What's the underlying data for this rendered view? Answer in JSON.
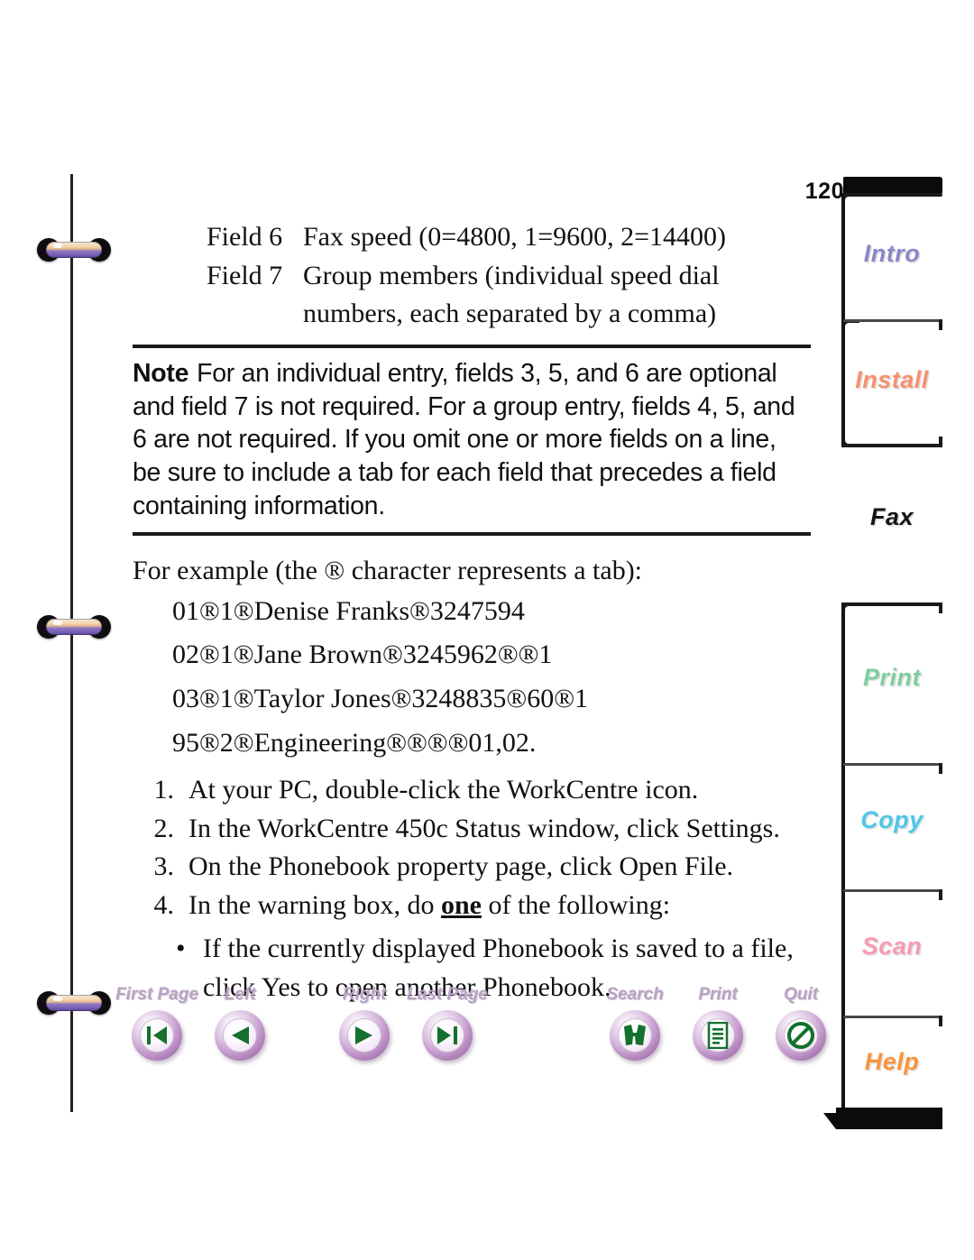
{
  "page": {
    "number": "120"
  },
  "fields": [
    {
      "label": "Field 6",
      "text": "Fax speed (0=4800, 1=9600, 2=14400)"
    },
    {
      "label": "Field 7",
      "text": "Group members (individual speed dial",
      "cont": "numbers, each separated by a comma)"
    }
  ],
  "note": {
    "word": "Note",
    "body": "For an individual entry, fields 3, 5, and 6 are optional and field 7 is not required. For a group entry, fields 4, 5, and 6 are not required. If you omit one or more fields on a line, be sure to include a tab for each field that precedes a field containing information."
  },
  "example": {
    "intro": "For example (the ® character represents a tab):",
    "lines": [
      "01®1®Denise Franks®3247594",
      "02®1®Jane Brown®3245962®®1",
      "03®1®Taylor Jones®3248835®60®1",
      "95®2®Engineering®®®®01,02."
    ]
  },
  "steps": [
    {
      "num": "1.",
      "text": "At your PC, double-click the WorkCentre icon."
    },
    {
      "num": "2.",
      "text": "In the WorkCentre 450c Status window, click Settings."
    },
    {
      "num": "3.",
      "text": "On the Phonebook property page, click Open File."
    },
    {
      "num": "4.",
      "pre": "In the warning box, do ",
      "emphasis": "one",
      "post": " of the following:"
    }
  ],
  "bullets": [
    {
      "dot": "•",
      "line1": "If the currently displayed Phonebook is saved to a",
      "line2": "file, click Yes to open another Phonebook."
    }
  ],
  "navbar": {
    "left": [
      {
        "label": "First Page",
        "icon": "first-page-icon"
      },
      {
        "label": "Left",
        "icon": "previous-page-icon"
      }
    ],
    "right_group": [
      {
        "label": "Right",
        "icon": "next-page-icon"
      },
      {
        "label": "Last Page",
        "icon": "last-page-icon"
      }
    ],
    "tools": [
      {
        "label": "Search",
        "icon": "binoculars-icon"
      },
      {
        "label": "Print",
        "icon": "document-print-icon"
      },
      {
        "label": "Quit",
        "icon": "no-entry-icon"
      }
    ],
    "label_color": "#b9a3c4",
    "glyph_color": "#15702e"
  },
  "tabs": [
    {
      "label": "Intro",
      "color": "#8b86c9",
      "active": false
    },
    {
      "label": "Install",
      "color": "#f79070",
      "active": false
    },
    {
      "label": "Fax",
      "color": "#141414",
      "active": true
    },
    {
      "label": "Print",
      "color": "#7fce9e",
      "active": false
    },
    {
      "label": "Copy",
      "color": "#4ec6e8",
      "active": false
    },
    {
      "label": "Scan",
      "color": "#f79bb0",
      "active": false
    },
    {
      "label": "Help",
      "color": "#f9943b",
      "active": false
    }
  ]
}
